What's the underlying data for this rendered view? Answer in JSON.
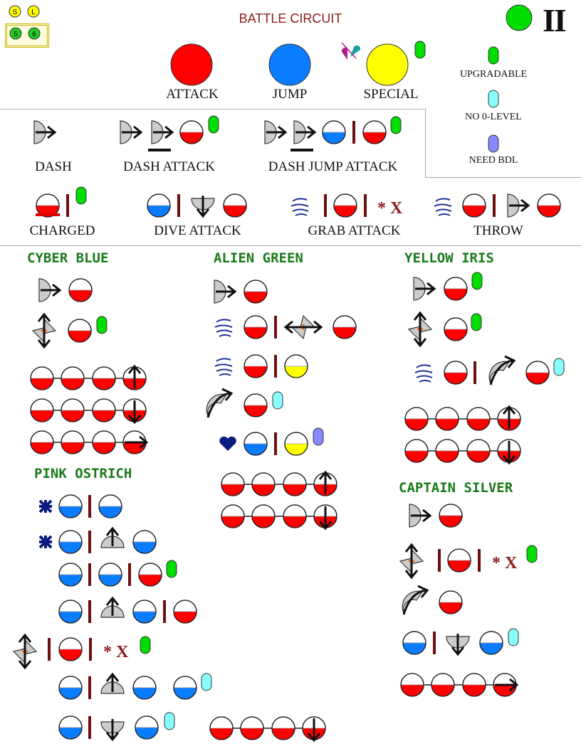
{
  "header": {
    "title": "BATTLE CIRCUIT",
    "roman": "II",
    "top_buttons": [
      "S",
      "L",
      "5",
      "6"
    ]
  },
  "buttons": [
    {
      "label": "ATTACK",
      "color": "#ff0000"
    },
    {
      "label": "JUMP",
      "color": "#0a7cff"
    },
    {
      "label": "SPECIAL",
      "color": "#ffff00"
    }
  ],
  "legend": {
    "upgradable": "UPGRADABLE",
    "no_zero": "NO 0-LEVEL",
    "need_bdl": "NEED BDL"
  },
  "moves": {
    "dash": "DASH",
    "dash_attack": "DASH ATTACK",
    "dash_jump_attack": "DASH JUMP ATTACK",
    "charged": "CHARGED",
    "dive_attack": "DIVE ATTACK",
    "grab_attack": "GRAB ATTACK",
    "throw": "THROW",
    "star_x": "* X"
  },
  "characters": {
    "cyber_blue": "CYBER BLUE",
    "alien_green": "ALIEN GREEN",
    "yellow_iris": "YELLOW IRIS",
    "pink_ostrich": "PINK OSTRICH",
    "captain_silver": "CAPTAIN SILVER"
  },
  "colors": {
    "attack": "#ff0000",
    "jump": "#0a7cff",
    "special": "#ffff00",
    "upgradable": "#00dd00",
    "no_zero": "#88ffff",
    "need_bdl": "#8888ff",
    "accent": "#8b1a1a",
    "name": "#1a7a1a"
  }
}
